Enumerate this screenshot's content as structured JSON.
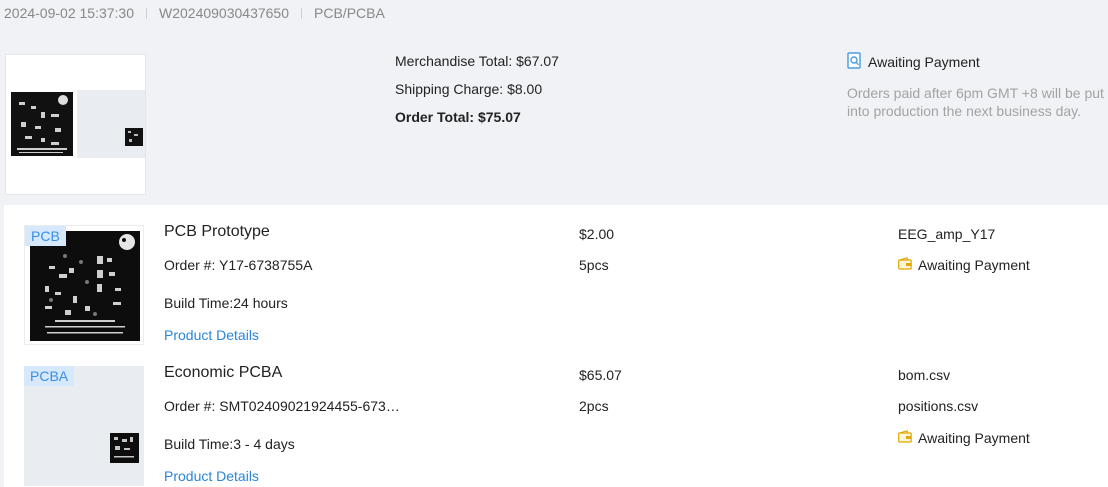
{
  "header": {
    "date": "2024-09-02 15:37:30",
    "order_id": "W202409030437650",
    "category": "PCB/PCBA"
  },
  "summary": {
    "merchandise_total": "Merchandise Total: $67.07",
    "shipping_charge": "Shipping Charge: $8.00",
    "order_total": "Order Total: $75.07",
    "status": "Awaiting Payment",
    "note": "Orders paid after 6pm GMT +8 will be put into production the next business day."
  },
  "items": [
    {
      "tag": "PCB",
      "title": "PCB Prototype",
      "order_no": "Order #: Y17-6738755A",
      "build_time": "Build Time:24 hours",
      "details_link": "Product Details",
      "price": "$2.00",
      "qty": "5pcs",
      "file1": "EEG_amp_Y17",
      "status": "Awaiting Payment"
    },
    {
      "tag": "PCBA",
      "title": "Economic PCBA",
      "order_no": "Order #: SMT02409021924455-673…",
      "build_time": "Build Time:3 - 4 days",
      "details_link": "Product Details",
      "price": "$65.07",
      "qty": "2pcs",
      "file1": "bom.csv",
      "file2": "positions.csv",
      "status": "Awaiting Payment"
    }
  ],
  "colors": {
    "link": "#2a86d8",
    "tag_bg": "#d6e8fb",
    "tag_text": "#3a8ee6",
    "muted": "#a3a3a3",
    "status_icon": "#e0a800"
  },
  "icons": {
    "summary_status": "search-document-icon",
    "item_status": "wallet-icon"
  }
}
